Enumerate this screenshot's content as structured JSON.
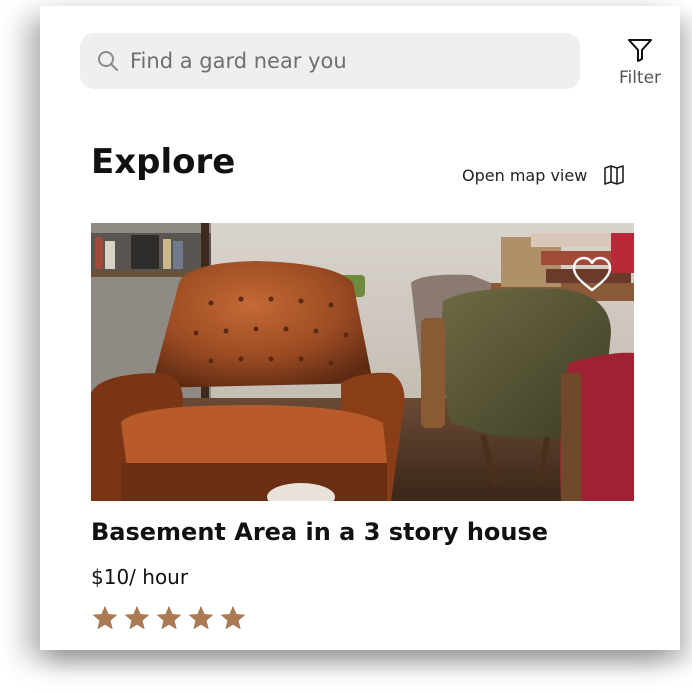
{
  "search": {
    "placeholder": "Find a gard near you"
  },
  "filter": {
    "label": "Filter"
  },
  "page_title": "Explore",
  "map_toggle": {
    "label": "Open map view"
  },
  "listing": {
    "title": "Basement Area in a 3 story house",
    "price": "$10/ hour",
    "rating": 5,
    "max_rating": 5,
    "favorited": false
  },
  "icons": {
    "search": "search-icon",
    "filter": "filter-icon",
    "map": "map-icon",
    "heart": "heart-outline-icon",
    "star": "star-icon"
  },
  "colors": {
    "star": "#a97a53",
    "search_bg": "#efefef",
    "text_primary": "#111111"
  }
}
